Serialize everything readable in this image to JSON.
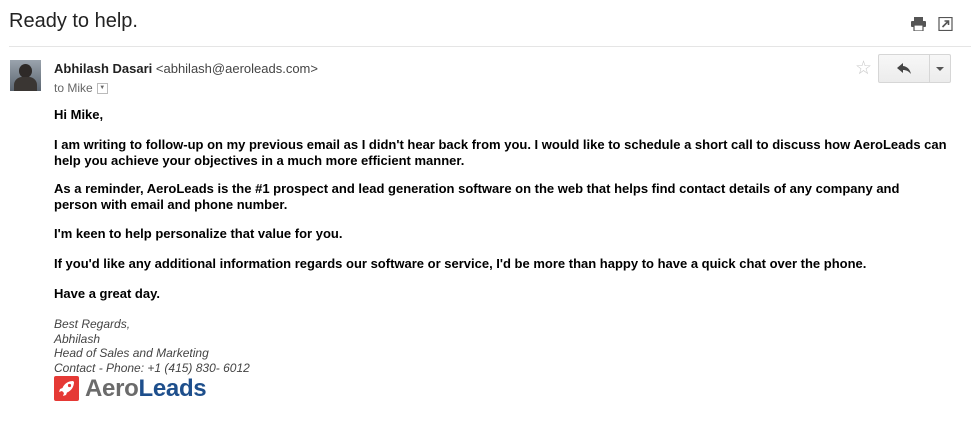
{
  "email": {
    "subject": "Ready to help.",
    "sender_name": "Abhilash Dasari",
    "sender_email": "<abhilash@aeroleads.com>",
    "to_line": "to Mike",
    "greeting": "Hi Mike,",
    "paragraphs": [
      "I am writing to follow-up on my previous email as I didn't hear back from you. I would like to schedule a short call to discuss how AeroLeads can help you achieve your objectives in a much more efficient manner.",
      "As a reminder, AeroLeads is the #1  prospect and lead generation software on the web that helps find contact details of any company and person with email and phone number.",
      "I'm keen to help personalize that value for you.",
      "If you'd like any additional information regards our software or service, I'd be more than happy to have a quick chat over the phone.",
      "Have a great day."
    ],
    "signature": [
      "Best Regards,",
      "Abhilash",
      "Head of Sales and Marketing",
      "Contact - Phone: +1 (415) 830- 6012"
    ]
  },
  "logo": {
    "part1": "Aero",
    "part2": "Leads"
  },
  "icons": {
    "print": "print-icon",
    "new_window": "new-window-icon",
    "star": "star-icon",
    "reply": "reply-icon",
    "more": "chevron-down-icon"
  },
  "colors": {
    "brand_red": "#e53935",
    "brand_blue": "#1e4f8c",
    "brand_gray": "#6b6b6b"
  }
}
